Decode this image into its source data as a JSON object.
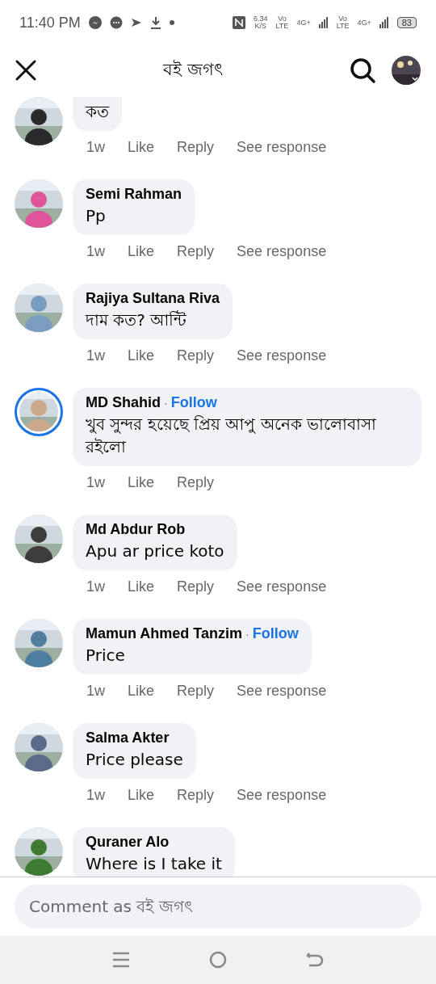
{
  "status_bar": {
    "time": "11:40 PM",
    "speed": "6.34",
    "speed_unit": "K/S",
    "sim1": "Vo",
    "sim1_sub": "LTE",
    "net1": "4G+",
    "sim2": "Vo",
    "sim2_sub": "LTE",
    "net2": "4G+",
    "battery": "83"
  },
  "header": {
    "title": "বই জগৎ"
  },
  "comments": [
    {
      "text": "কত",
      "cut": true,
      "story_ring": false,
      "actions": [
        "1w",
        "Like",
        "Reply",
        "See response"
      ]
    },
    {
      "name": "Semi Rahman",
      "text": "Pp",
      "story_ring": false,
      "actions": [
        "1w",
        "Like",
        "Reply",
        "See response"
      ]
    },
    {
      "name": "Rajiya Sultana Riva",
      "text": "দাম কত? আন্টি",
      "story_ring": false,
      "actions": [
        "1w",
        "Like",
        "Reply",
        "See response"
      ]
    },
    {
      "name": "MD Shahid",
      "separator": "·",
      "follow": "Follow",
      "text": "খুব সুন্দর হয়েছে প্রিয় আপু অনেক ভালোবাসা রইলো",
      "story_ring": true,
      "actions": [
        "1w",
        "Like",
        "Reply"
      ]
    },
    {
      "name": "Md Abdur Rob",
      "text": "Apu ar price koto",
      "story_ring": false,
      "actions": [
        "1w",
        "Like",
        "Reply",
        "See response"
      ]
    },
    {
      "name": "Mamun Ahmed Tanzim",
      "separator": "·",
      "follow": "Follow",
      "text": "Price",
      "story_ring": false,
      "actions": [
        "1w",
        "Like",
        "Reply",
        "See response"
      ]
    },
    {
      "name": "Salma Akter",
      "text": "Price please",
      "story_ring": false,
      "actions": [
        "1w",
        "Like",
        "Reply",
        "See response"
      ]
    },
    {
      "name": "Quraner Alo",
      "text": "Where is I take it",
      "story_ring": false
    }
  ],
  "composer": {
    "placeholder": "Comment as বই জগৎ"
  }
}
